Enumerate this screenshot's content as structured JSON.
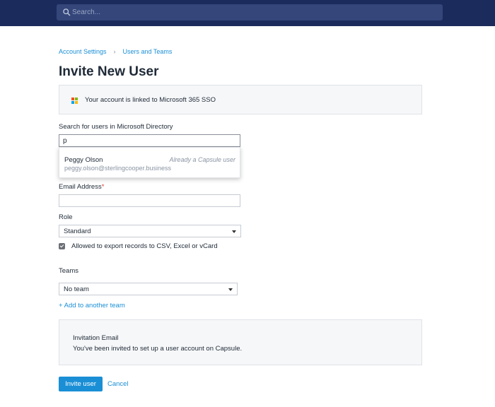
{
  "header": {
    "search_placeholder": "Search..."
  },
  "breadcrumb": {
    "items": [
      "Account Settings",
      "Users and Teams"
    ],
    "separator": "›"
  },
  "page": {
    "title": "Invite New User"
  },
  "sso": {
    "text": "Your account is linked to Microsoft 365 SSO",
    "logo_colors": [
      "#f25022",
      "#7fba00",
      "#00a4ef",
      "#ffb900"
    ]
  },
  "directory_search": {
    "label": "Search for users in Microsoft Directory",
    "value": "p",
    "results": [
      {
        "name": "Peggy Olson",
        "email": "peggy.olson@sterlingcooper.business",
        "note": "Already a Capsule user"
      }
    ]
  },
  "email": {
    "label": "Email Address",
    "required_mark": "*",
    "value": ""
  },
  "role": {
    "label": "Role",
    "selected": "Standard"
  },
  "export": {
    "checked": true,
    "label": "Allowed to export records to CSV, Excel or vCard"
  },
  "teams": {
    "label": "Teams",
    "selected": "No team",
    "add_link": "+ Add to another team"
  },
  "invitation": {
    "title": "Invitation Email",
    "body": "You've been invited to set up a user account on Capsule."
  },
  "actions": {
    "invite_label": "Invite user",
    "cancel_label": "Cancel"
  },
  "colors": {
    "header_bg": "#1b2b5b",
    "accent": "#1a8fd6",
    "required": "#d93a3a"
  }
}
